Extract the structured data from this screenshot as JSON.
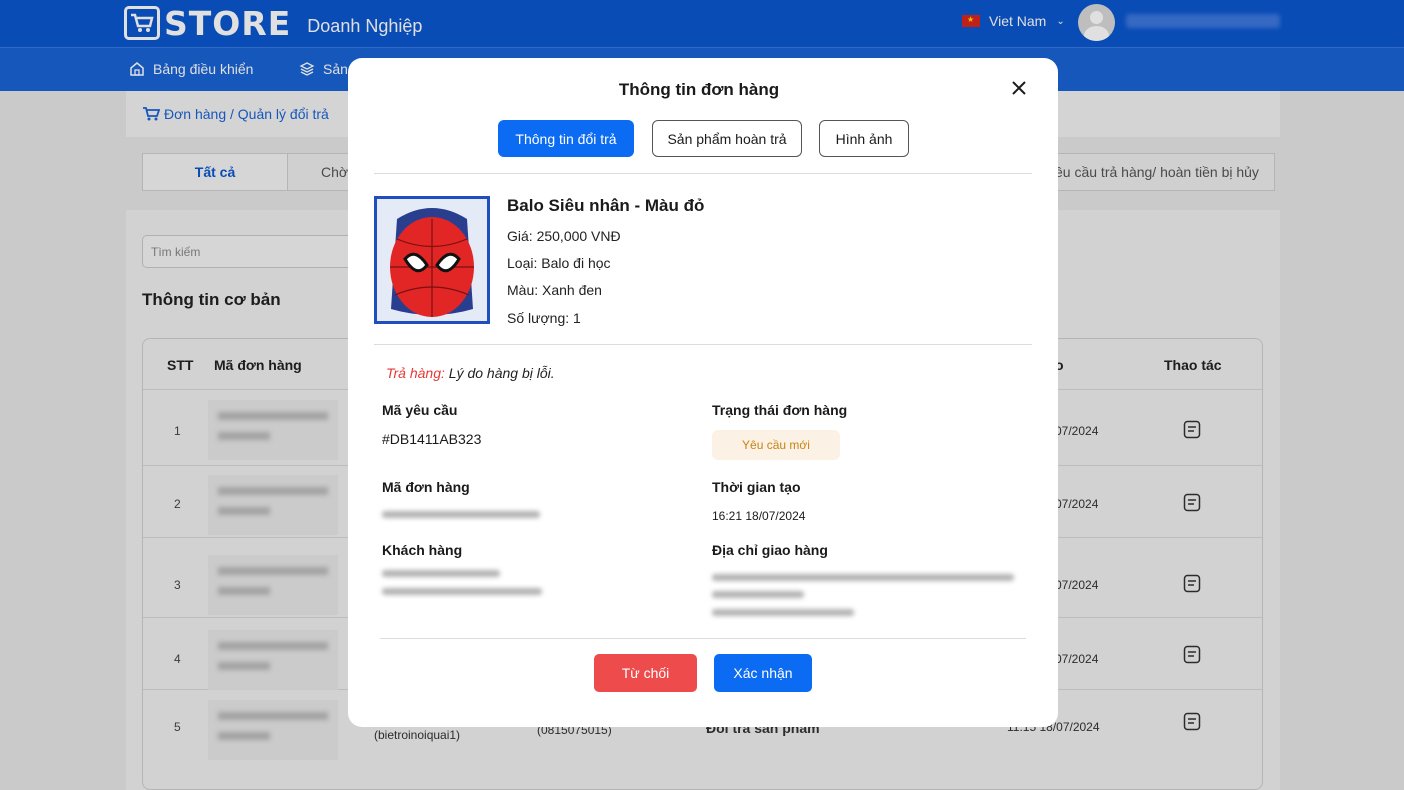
{
  "header": {
    "logo_text": "STORE",
    "logo_sub": "Doanh Nghiệp",
    "language": "Viet Nam"
  },
  "nav": {
    "dashboard": "Bảng điều khiển",
    "products": "Sản"
  },
  "breadcrumb": "Đơn hàng / Quản lý đổi trả",
  "tabs": {
    "all": "Tất cả",
    "waiting": "Chờ",
    "cancelled": "êu cầu trả hàng/ hoàn tiền bị hủy"
  },
  "search": {
    "placeholder": "Tìm kiếm"
  },
  "section_title": "Thông tin cơ bản",
  "table": {
    "headers": {
      "stt": "STT",
      "order_code": "Mã đơn hàng",
      "date": "o",
      "action": "Thao tác"
    },
    "rows": [
      {
        "stt": "1",
        "date": "07/2024"
      },
      {
        "stt": "2",
        "date": "07/2024"
      },
      {
        "stt": "3",
        "date": "07/2024"
      },
      {
        "stt": "4",
        "date": "07/2024"
      },
      {
        "stt": "5",
        "date": "11:15 18/07/2024",
        "customer": "(bietroinoiquai1)",
        "phone": "(0815075015)",
        "type": "Đổi trả sản phẩm"
      }
    ]
  },
  "modal": {
    "title": "Thông tin đơn hàng",
    "tabs": [
      "Thông tin đổi trả",
      "Sản phẩm hoàn trả",
      "Hình ảnh"
    ],
    "product": {
      "name": "Balo Siêu nhân - Màu đỏ",
      "price": "Giá: 250,000 VNĐ",
      "category": "Loại: Balo đi học",
      "color": "Màu: Xanh đen",
      "quantity": "Số lượng: 1"
    },
    "reason_label": "Trả hàng:",
    "reason_text": " Lý do hàng bị lỗi.",
    "fields": {
      "request_code_label": "Mã yêu cầu",
      "request_code": "#DB1411AB323",
      "order_status_label": "Trạng thái đơn hàng",
      "order_status": "Yêu cầu mới",
      "order_code_label": "Mã đơn hàng",
      "created_label": "Thời gian tạo",
      "created": "16:21 18/07/2024",
      "customer_label": "Khách hàng",
      "address_label": "Địa chỉ giao hàng"
    },
    "buttons": {
      "reject": "Từ chối",
      "confirm": "Xác nhận"
    },
    "colors": {
      "primary": "#0b6bf2",
      "danger": "#ee4c4c",
      "status_bg": "#fbf1e4",
      "status_text": "#c98310"
    }
  }
}
